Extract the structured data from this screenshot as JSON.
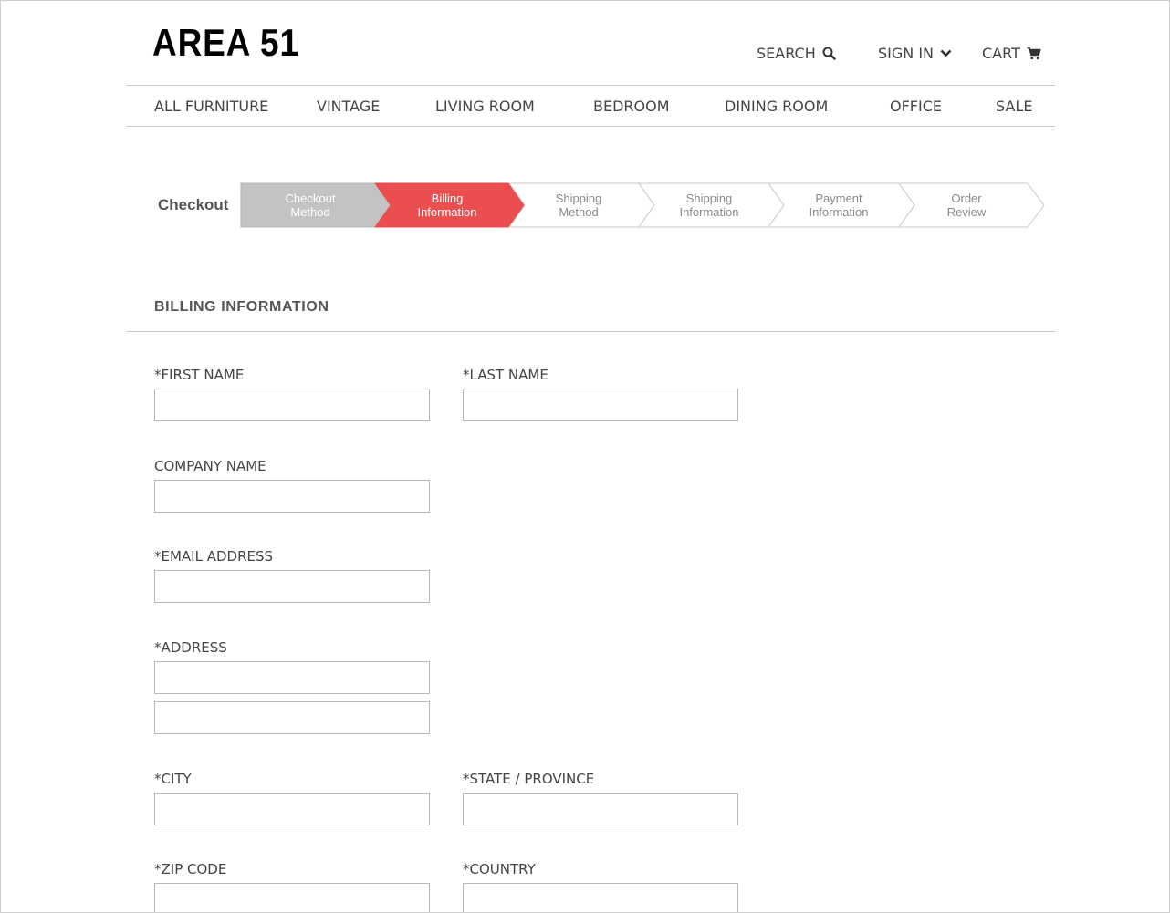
{
  "brand": {
    "logo_text": "AREA 51"
  },
  "header": {
    "search_label": "SEARCH",
    "signin_label": "SIGN IN",
    "cart_label": "CART"
  },
  "nav": {
    "items": [
      "ALL FURNITURE",
      "VINTAGE",
      "LIVING ROOM",
      "BEDROOM",
      "DINING ROOM",
      "OFFICE",
      "SALE"
    ]
  },
  "checkout": {
    "label": "Checkout",
    "steps": [
      {
        "line1": "Checkout",
        "line2": "Method",
        "state": "completed"
      },
      {
        "line1": "Billing",
        "line2": "Information",
        "state": "active"
      },
      {
        "line1": "Shipping",
        "line2": "Method",
        "state": "upcoming"
      },
      {
        "line1": "Shipping",
        "line2": "Information",
        "state": "upcoming"
      },
      {
        "line1": "Payment",
        "line2": "Information",
        "state": "upcoming"
      },
      {
        "line1": "Order",
        "line2": "Review",
        "state": "upcoming"
      }
    ]
  },
  "billing": {
    "title": "BILLING INFORMATION",
    "first_name_label": "*FIRST NAME",
    "first_name_value": "",
    "last_name_label": "*LAST NAME",
    "last_name_value": "",
    "company_label": "COMPANY NAME",
    "company_value": "",
    "email_label": "*EMAIL ADDRESS",
    "email_value": "",
    "address_label": "*ADDRESS",
    "address_line1_value": "",
    "address_line2_value": "",
    "city_label": "*CITY",
    "city_value": "",
    "state_label": "*STATE / PROVINCE",
    "state_value": "",
    "zip_label": "*ZIP CODE",
    "zip_value": "",
    "country_label": "*COUNTRY",
    "country_value": ""
  },
  "colors": {
    "active_step": "#ea4e4f",
    "completed_step": "#c3c3c3",
    "upcoming_border": "#c8c8c8",
    "upcoming_text": "#8a8a8a"
  },
  "icons": {
    "search": "search-icon",
    "signin": "chevron-down-icon",
    "cart": "cart-icon"
  }
}
